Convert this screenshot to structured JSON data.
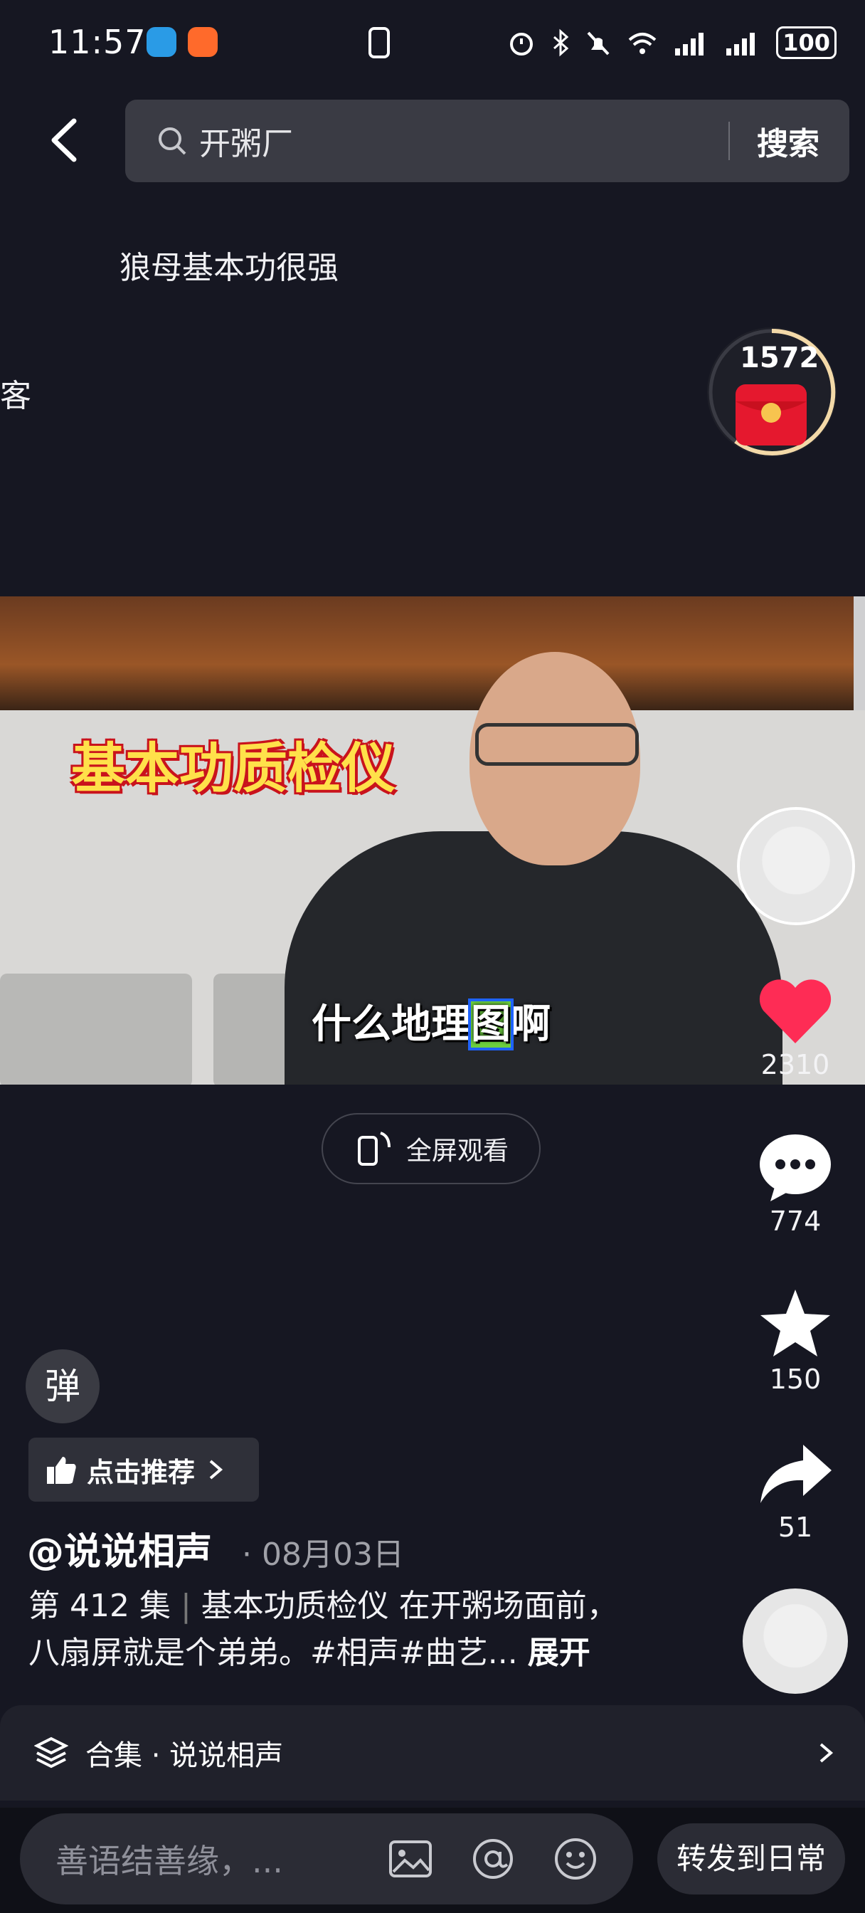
{
  "status_bar": {
    "time": "11:57",
    "battery": "100"
  },
  "search": {
    "query": "开粥厂",
    "button_label": "搜索"
  },
  "top_caption": "狼母基本功很强",
  "side_char": "客",
  "red_packet": {
    "count": "1572"
  },
  "video": {
    "title_sticker": "基本功质检仪",
    "subtitle_prefix": "什么地理",
    "subtitle_highlight": "图",
    "subtitle_suffix": "啊"
  },
  "actions": {
    "likes": "2310",
    "comments": "774",
    "favorites": "150",
    "shares": "51"
  },
  "fullscreen_label": "全屏观看",
  "danmaku_label": "弹",
  "recommend_label": "点击推荐",
  "post": {
    "author": "@说说相声",
    "date": "· 08月03日",
    "episode": "第 412 集",
    "desc_line1": "基本功质检仪 在开粥场面前，",
    "desc_line2": "八扇屏就是个弟弟。#相声#曲艺...",
    "expand": "展开"
  },
  "collection": {
    "label": "合集 · 说说相声"
  },
  "bottom_bar": {
    "comment_placeholder": "善语结善缘，...",
    "forward_label": "转发到日常"
  },
  "colors": {
    "background": "#161722",
    "like": "#fe2c55",
    "sticker_text": "#ffe14a"
  }
}
